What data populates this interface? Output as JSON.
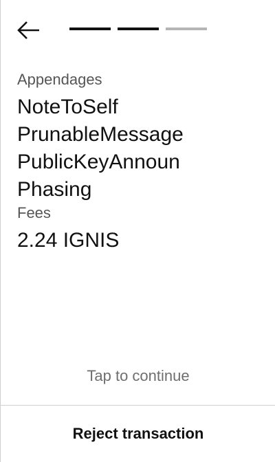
{
  "header": {
    "back_icon": "arrow-left-icon",
    "progress": {
      "total_steps": 3,
      "completed_steps": 2
    }
  },
  "appendages": {
    "label": "Appendages",
    "items": [
      "NoteToSelf",
      "PrunableMessage",
      "PublicKeyAnnoun",
      "Phasing"
    ]
  },
  "fees": {
    "label": "Fees",
    "value": "2.24 IGNIS"
  },
  "footer": {
    "tap_hint": "Tap to continue",
    "reject_label": "Reject transaction"
  },
  "colors": {
    "text_primary": "#111111",
    "text_secondary": "#555555",
    "progress_active": "#111111",
    "progress_inactive": "#b5b5b5",
    "divider": "#cfcfcf"
  }
}
